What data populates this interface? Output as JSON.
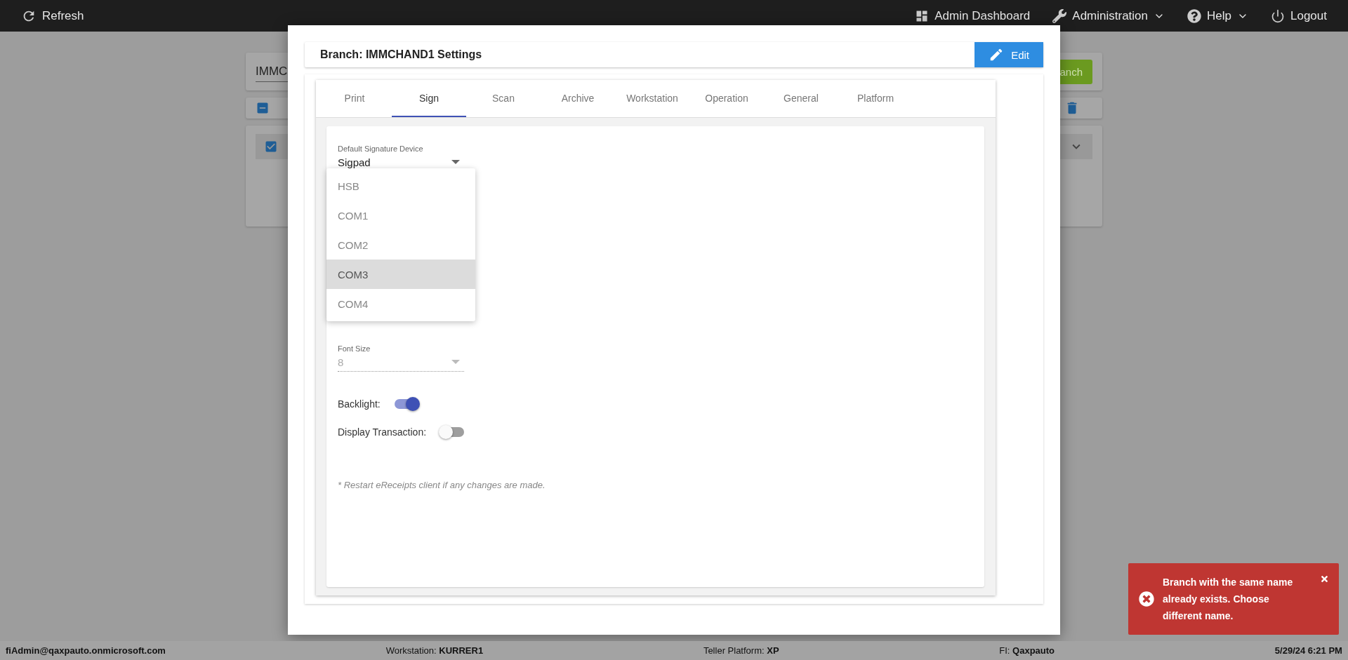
{
  "top_bar": {
    "left": [
      {
        "label": "Refresh"
      }
    ],
    "right": [
      {
        "label": "Admin Dashboard",
        "kind": "link"
      },
      {
        "label": "Administration",
        "kind": "menu"
      },
      {
        "label": "Help",
        "kind": "menu"
      },
      {
        "label": "Logout",
        "kind": "link"
      }
    ]
  },
  "background_page": {
    "search_value": "IMMC",
    "button_label": "anch"
  },
  "modal": {
    "title": "Branch: IMMCHAND1 Settings",
    "edit_button": "Edit",
    "tabs": [
      {
        "label": "Print",
        "selected": false
      },
      {
        "label": "Sign",
        "selected": true
      },
      {
        "label": "Scan",
        "selected": false
      },
      {
        "label": "Archive",
        "selected": false
      },
      {
        "label": "Workstation",
        "selected": false
      },
      {
        "label": "Operation",
        "selected": false
      },
      {
        "label": "General",
        "selected": false
      },
      {
        "label": "Platform",
        "selected": false
      }
    ],
    "fields": [
      {
        "label": "Default Signature Device",
        "value": "Sigpad",
        "disabled": false
      },
      {
        "label": "Font Size",
        "value": "8",
        "disabled": true
      }
    ],
    "dropdown_menu": {
      "options": [
        {
          "label": "HSB",
          "selected": false
        },
        {
          "label": "COM1",
          "selected": false
        },
        {
          "label": "COM2",
          "selected": false
        },
        {
          "label": "COM3",
          "selected": true
        },
        {
          "label": "COM4",
          "selected": false
        }
      ]
    },
    "toggles": [
      {
        "label": "Backlight:",
        "on": true
      },
      {
        "label": "Display Transaction:",
        "on": false
      }
    ],
    "note": "* Restart eReceipts client if any changes are made."
  },
  "toast": {
    "message": "Branch with the same name already exists. Choose different name."
  },
  "status_bar": [
    {
      "value": "fiAdmin@qaxpauto.onmicrosoft.com"
    },
    {
      "label": "Workstation:",
      "value": "KURRER1"
    },
    {
      "label": "Teller Platform:",
      "value": "XP"
    },
    {
      "label": "FI:",
      "value": "Qaxpauto"
    },
    {
      "value": "5/29/24 6:21 PM"
    }
  ]
}
